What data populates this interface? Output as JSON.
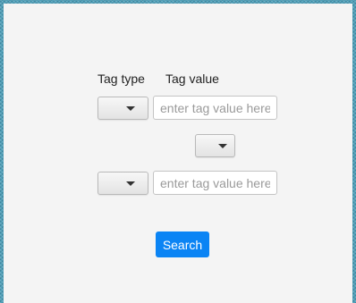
{
  "form": {
    "tag_type_label": "Tag type",
    "tag_value_label": "Tag value",
    "rows": [
      {
        "type_value": "",
        "value_placeholder": "enter tag value here",
        "value": ""
      },
      {
        "type_value": "",
        "value_placeholder": "enter tag value here",
        "value": ""
      }
    ],
    "operator_value": "",
    "search_label": "Search"
  },
  "icons": {
    "dropdown": "chevron-down-icon"
  },
  "colors": {
    "background": "#4f9fb8",
    "panel": "#f4f4f4",
    "accent": "#0b84f4"
  }
}
